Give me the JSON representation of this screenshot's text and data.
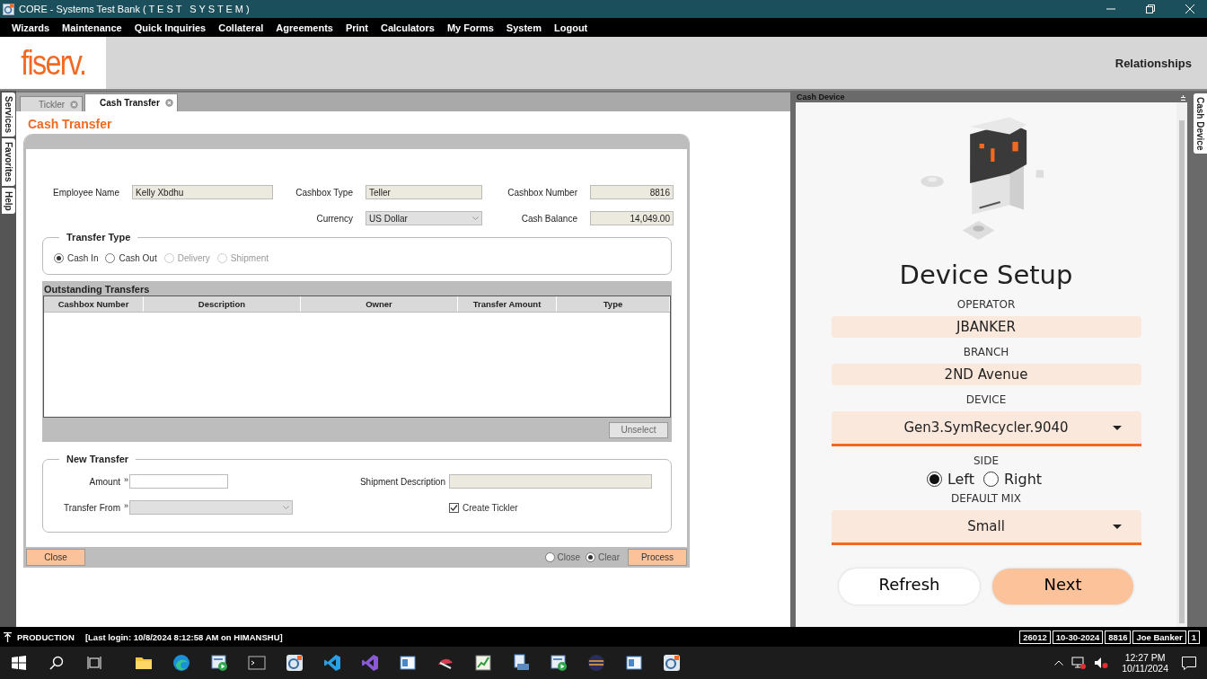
{
  "window": {
    "title": "CORE - Systems Test Bank ( T E S T   S Y S T E M )"
  },
  "menu": [
    "Wizards",
    "Maintenance",
    "Quick Inquiries",
    "Collateral",
    "Agreements",
    "Print",
    "Calculators",
    "My Forms",
    "System",
    "Logout"
  ],
  "header": {
    "logo": "fiserv.",
    "link": "Relationships"
  },
  "side_tabs": [
    "Services",
    "Favorites",
    "Help"
  ],
  "tabs": [
    {
      "label": "Tickler",
      "selected": false
    },
    {
      "label": "Cash Transfer",
      "selected": true
    }
  ],
  "form": {
    "title": "Cash Transfer",
    "rows": [
      [
        {
          "label": "Employee Name",
          "value": "Kelly Xbdhu",
          "kind": "text"
        },
        {
          "label": "Cashbox Type",
          "value": "Teller",
          "kind": "text"
        },
        {
          "label": "Cashbox Number",
          "value": "8816",
          "kind": "number"
        }
      ],
      [
        "",
        {
          "label": "Currency",
          "value": "US Dollar",
          "kind": "select"
        },
        {
          "label": "Cash Balance",
          "value": "14,049.00",
          "kind": "number"
        }
      ]
    ],
    "transfer_type": {
      "title": "Transfer Type",
      "options": [
        {
          "label": "Cash In",
          "selected": true,
          "disabled": false
        },
        {
          "label": "Cash Out",
          "selected": false,
          "disabled": false
        },
        {
          "label": "Delivery",
          "selected": false,
          "disabled": true
        },
        {
          "label": "Shipment",
          "selected": false,
          "disabled": true
        }
      ]
    },
    "outstanding": {
      "title": "Outstanding Transfers",
      "columns": [
        "Cashbox Number",
        "Description",
        "Owner",
        "Transfer Amount",
        "Type"
      ],
      "button": "Unselect"
    },
    "new_transfer": {
      "title": "New Transfer",
      "amount": {
        "label": "Amount",
        "marker": "»"
      },
      "shipment": {
        "label": "Shipment Description"
      },
      "from": {
        "label": "Transfer From",
        "marker": "»"
      },
      "tickler": {
        "label": "Create Tickler",
        "checked": true
      }
    },
    "footer": {
      "close": "Close",
      "options": [
        {
          "label": "Close",
          "selected": false
        },
        {
          "label": "Clear",
          "selected": true
        }
      ],
      "process": "Process"
    }
  },
  "device_panel": {
    "title": "Cash Device",
    "side_tab": "Cash Device",
    "heading": "Device Setup",
    "items": [
      {
        "kind": "value",
        "label": "OPERATOR",
        "value": "JBANKER"
      },
      {
        "kind": "value",
        "label": "BRANCH",
        "value": "2ND Avenue"
      },
      {
        "kind": "dropdown",
        "label": "DEVICE",
        "value": "Gen3.SymRecycler.9040"
      },
      {
        "kind": "radio",
        "label": "SIDE",
        "options": [
          {
            "label": "Left",
            "selected": true
          },
          {
            "label": "Right",
            "selected": false
          }
        ]
      },
      {
        "kind": "dropdown",
        "label": "DEFAULT MIX",
        "value": "Small"
      }
    ],
    "buttons": [
      {
        "label": "Refresh",
        "primary": false
      },
      {
        "label": "Next",
        "primary": true
      }
    ]
  },
  "status_bar": {
    "mode": "PRODUCTION",
    "login": "[Last login: 10/8/2024 8:12:58 AM on HIMANSHU]",
    "cells": [
      "26012",
      "10-30-2024",
      "8816",
      "Joe Banker",
      "1"
    ]
  },
  "taskbar": {
    "apps": [
      {
        "kind": "folder"
      },
      {
        "kind": "browser"
      },
      {
        "kind": "player"
      },
      {
        "kind": "terminal"
      },
      {
        "kind": "core"
      },
      {
        "kind": "code"
      },
      {
        "kind": "studio"
      },
      {
        "kind": "window"
      },
      {
        "kind": "tool"
      },
      {
        "kind": "chart"
      },
      {
        "kind": "document"
      },
      {
        "kind": "player"
      },
      {
        "kind": "globe"
      },
      {
        "kind": "window"
      },
      {
        "kind": "core"
      }
    ],
    "time": "12:27 PM",
    "date": "10/11/2024"
  }
}
